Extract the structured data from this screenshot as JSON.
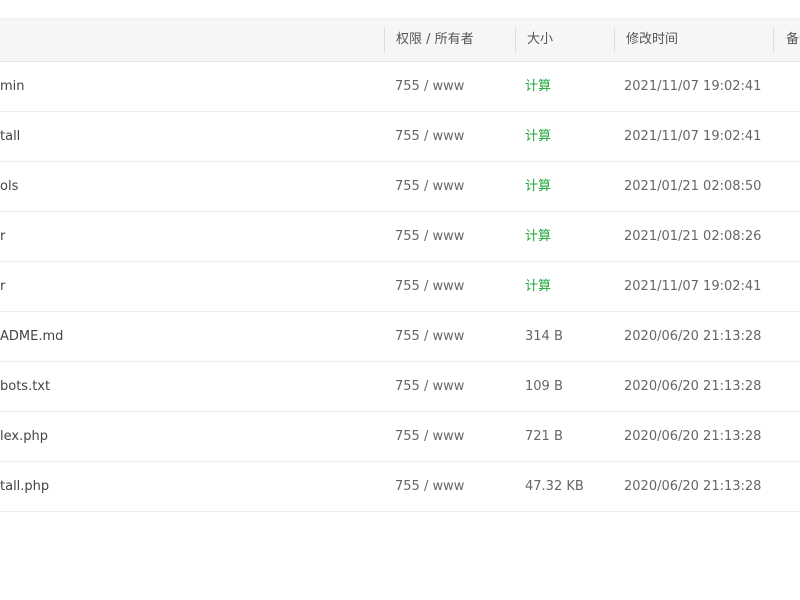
{
  "table": {
    "headers": {
      "name": "",
      "permissions": "权限 / 所有者",
      "size": "大小",
      "modified": "修改时间",
      "note": "备注"
    },
    "rows": [
      {
        "name": "min",
        "permissions": "755 / www",
        "size": "计算",
        "size_is_action": true,
        "modified": "2021/11/07 19:02:41"
      },
      {
        "name": "tall",
        "permissions": "755 / www",
        "size": "计算",
        "size_is_action": true,
        "modified": "2021/11/07 19:02:41"
      },
      {
        "name": "ols",
        "permissions": "755 / www",
        "size": "计算",
        "size_is_action": true,
        "modified": "2021/01/21 02:08:50"
      },
      {
        "name": "r",
        "permissions": "755 / www",
        "size": "计算",
        "size_is_action": true,
        "modified": "2021/01/21 02:08:26"
      },
      {
        "name": "r",
        "permissions": "755 / www",
        "size": "计算",
        "size_is_action": true,
        "modified": "2021/11/07 19:02:41"
      },
      {
        "name": "ADME.md",
        "permissions": "755 / www",
        "size": "314 B",
        "size_is_action": false,
        "modified": "2020/06/20 21:13:28"
      },
      {
        "name": "bots.txt",
        "permissions": "755 / www",
        "size": "109 B",
        "size_is_action": false,
        "modified": "2020/06/20 21:13:28"
      },
      {
        "name": "lex.php",
        "permissions": "755 / www",
        "size": "721 B",
        "size_is_action": false,
        "modified": "2020/06/20 21:13:28"
      },
      {
        "name": "tall.php",
        "permissions": "755 / www",
        "size": "47.32 KB",
        "size_is_action": false,
        "modified": "2020/06/20 21:13:28"
      }
    ]
  },
  "colors": {
    "calculate_link": "#20a53a",
    "header_bg": "#f6f6f6",
    "row_border": "#eeeeee"
  }
}
